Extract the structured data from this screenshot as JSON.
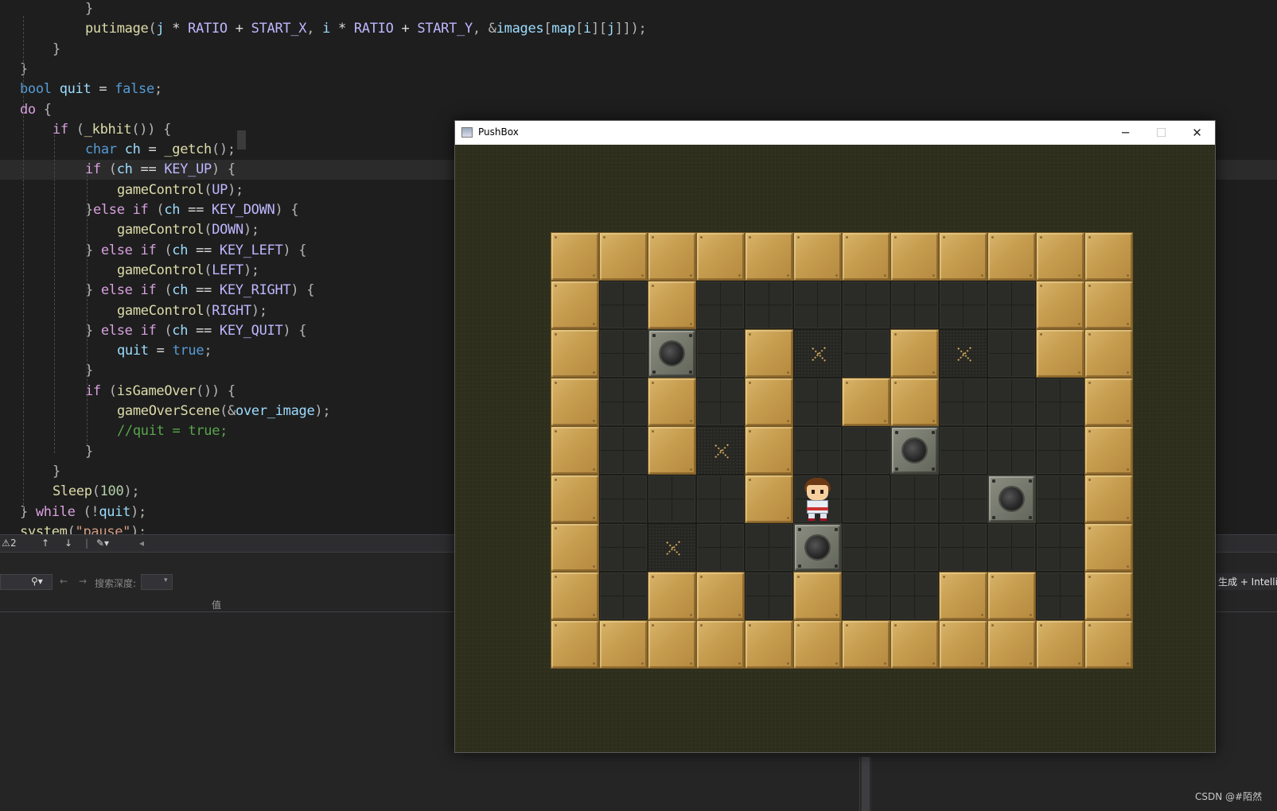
{
  "editor": {
    "lines": [
      [
        [
          "tk-pun",
          "}"
        ]
      ],
      [
        [
          "tk-fn",
          "putimage"
        ],
        [
          "tk-pun",
          "("
        ],
        [
          "tk-var",
          "j"
        ],
        [
          "tk-txt",
          " * "
        ],
        [
          "tk-mac2",
          "RATIO"
        ],
        [
          "tk-txt",
          " + "
        ],
        [
          "tk-mac2",
          "START_X"
        ],
        [
          "tk-pun",
          ", "
        ],
        [
          "tk-var",
          "i"
        ],
        [
          "tk-txt",
          " * "
        ],
        [
          "tk-mac2",
          "RATIO"
        ],
        [
          "tk-txt",
          " + "
        ],
        [
          "tk-mac2",
          "START_Y"
        ],
        [
          "tk-pun",
          ", &"
        ],
        [
          "tk-var",
          "images"
        ],
        [
          "tk-pun",
          "["
        ],
        [
          "tk-var",
          "map"
        ],
        [
          "tk-pun",
          "["
        ],
        [
          "tk-var",
          "i"
        ],
        [
          "tk-pun",
          "]["
        ],
        [
          "tk-var",
          "j"
        ],
        [
          "tk-pun",
          "]]);"
        ]
      ],
      [
        [
          "tk-pun",
          "}"
        ]
      ],
      [
        [
          "tk-pun",
          "}"
        ]
      ],
      [
        [
          "tk-kw",
          "bool"
        ],
        [
          "tk-txt",
          " "
        ],
        [
          "tk-var",
          "quit"
        ],
        [
          "tk-txt",
          " = "
        ],
        [
          "tk-kw",
          "false"
        ],
        [
          "tk-pun",
          ";"
        ]
      ],
      [
        [
          "tk-ctl",
          "do"
        ],
        [
          "tk-pun",
          " {"
        ]
      ],
      [
        [
          "tk-ctl",
          "if"
        ],
        [
          "tk-pun",
          " ("
        ],
        [
          "tk-fn",
          "_kbhit"
        ],
        [
          "tk-pun",
          "()) {"
        ]
      ],
      [
        [
          "tk-kw",
          "char"
        ],
        [
          "tk-txt",
          " "
        ],
        [
          "tk-var",
          "ch"
        ],
        [
          "tk-txt",
          " = "
        ],
        [
          "tk-fn",
          "_getch"
        ],
        [
          "tk-pun",
          "();"
        ]
      ],
      [
        [
          "tk-ctl",
          "if"
        ],
        [
          "tk-pun",
          " ("
        ],
        [
          "tk-var",
          "ch"
        ],
        [
          "tk-txt",
          " == "
        ],
        [
          "tk-mac2",
          "KEY_UP"
        ],
        [
          "tk-pun",
          ") {"
        ]
      ],
      [
        [
          "tk-fn",
          "gameControl"
        ],
        [
          "tk-pun",
          "("
        ],
        [
          "tk-mac2",
          "UP"
        ],
        [
          "tk-pun",
          ");"
        ]
      ],
      [
        [
          "tk-pun",
          "}"
        ],
        [
          "tk-ctl",
          "else if"
        ],
        [
          "tk-pun",
          " ("
        ],
        [
          "tk-var",
          "ch"
        ],
        [
          "tk-txt",
          " == "
        ],
        [
          "tk-mac2",
          "KEY_DOWN"
        ],
        [
          "tk-pun",
          ") {"
        ]
      ],
      [
        [
          "tk-fn",
          "gameControl"
        ],
        [
          "tk-pun",
          "("
        ],
        [
          "tk-mac2",
          "DOWN"
        ],
        [
          "tk-pun",
          ");"
        ]
      ],
      [
        [
          "tk-pun",
          "} "
        ],
        [
          "tk-ctl",
          "else if"
        ],
        [
          "tk-pun",
          " ("
        ],
        [
          "tk-var",
          "ch"
        ],
        [
          "tk-txt",
          " == "
        ],
        [
          "tk-mac2",
          "KEY_LEFT"
        ],
        [
          "tk-pun",
          ") {"
        ]
      ],
      [
        [
          "tk-fn",
          "gameControl"
        ],
        [
          "tk-pun",
          "("
        ],
        [
          "tk-mac2",
          "LEFT"
        ],
        [
          "tk-pun",
          ");"
        ]
      ],
      [
        [
          "tk-pun",
          "} "
        ],
        [
          "tk-ctl",
          "else if"
        ],
        [
          "tk-pun",
          " ("
        ],
        [
          "tk-var",
          "ch"
        ],
        [
          "tk-txt",
          " == "
        ],
        [
          "tk-mac2",
          "KEY_RIGHT"
        ],
        [
          "tk-pun",
          ") {"
        ]
      ],
      [
        [
          "tk-fn",
          "gameControl"
        ],
        [
          "tk-pun",
          "("
        ],
        [
          "tk-mac2",
          "RIGHT"
        ],
        [
          "tk-pun",
          ");"
        ]
      ],
      [
        [
          "tk-pun",
          "} "
        ],
        [
          "tk-ctl",
          "else if"
        ],
        [
          "tk-pun",
          " ("
        ],
        [
          "tk-var",
          "ch"
        ],
        [
          "tk-txt",
          " == "
        ],
        [
          "tk-mac2",
          "KEY_QUIT"
        ],
        [
          "tk-pun",
          ") {"
        ]
      ],
      [
        [
          "tk-var",
          "quit"
        ],
        [
          "tk-txt",
          " = "
        ],
        [
          "tk-kw",
          "true"
        ],
        [
          "tk-pun",
          ";"
        ]
      ],
      [
        [
          "tk-pun",
          "}"
        ]
      ],
      [
        [
          "tk-ctl",
          "if"
        ],
        [
          "tk-pun",
          " ("
        ],
        [
          "tk-fn",
          "isGameOver"
        ],
        [
          "tk-pun",
          "()) {"
        ]
      ],
      [
        [
          "tk-fn",
          "gameOverScene"
        ],
        [
          "tk-pun",
          "(&"
        ],
        [
          "tk-var",
          "over_image"
        ],
        [
          "tk-pun",
          ");"
        ]
      ],
      [
        [
          "tk-com",
          "//quit = true;"
        ]
      ],
      [
        [
          "tk-pun",
          "}"
        ]
      ],
      [
        [
          "tk-pun",
          "}"
        ]
      ],
      [
        [
          "tk-fn",
          "Sleep"
        ],
        [
          "tk-pun",
          "("
        ],
        [
          "tk-num",
          "100"
        ],
        [
          "tk-pun",
          ");"
        ]
      ],
      [
        [
          "tk-pun",
          "} "
        ],
        [
          "tk-ctl",
          "while"
        ],
        [
          "tk-pun",
          " (!"
        ],
        [
          "tk-var",
          "quit"
        ],
        [
          "tk-pun",
          ");"
        ]
      ],
      [
        [
          "tk-fn",
          "system"
        ],
        [
          "tk-pun",
          "("
        ],
        [
          "tk-str",
          "\"pause\""
        ],
        [
          "tk-pun",
          ");"
        ]
      ]
    ]
  },
  "status": {
    "warning_icon": "warning-triangle-icon",
    "warning_count": "2",
    "up_arrow": "↑",
    "down_arrow": "↓"
  },
  "panel": {
    "search_depth_label": "搜索深度:",
    "value_column": "值",
    "build_label": "生成 + Intelli"
  },
  "window": {
    "title": "PushBox",
    "minimize_glyph": "─",
    "maximize_glyph": "☐",
    "close_glyph": "✕"
  },
  "game": {
    "legend": {
      "W": "wall",
      "F": "floor",
      "T": "target",
      "B": "box",
      "P": "player"
    },
    "map": [
      "WWWWWWWWWWWW",
      "WFWFFFFFFFWW",
      "WFBFWTFWTFWW",
      "WFWFWFWWFFFW",
      "WFWTWFFBFFFW",
      "WFFFWPFFFBFW",
      "WFTFFBFFFFFW",
      "WFWWFWFFWWFW",
      "WWWWWWWWWWWW"
    ]
  },
  "footer": {
    "watermark": "CSDN @#陌然"
  }
}
